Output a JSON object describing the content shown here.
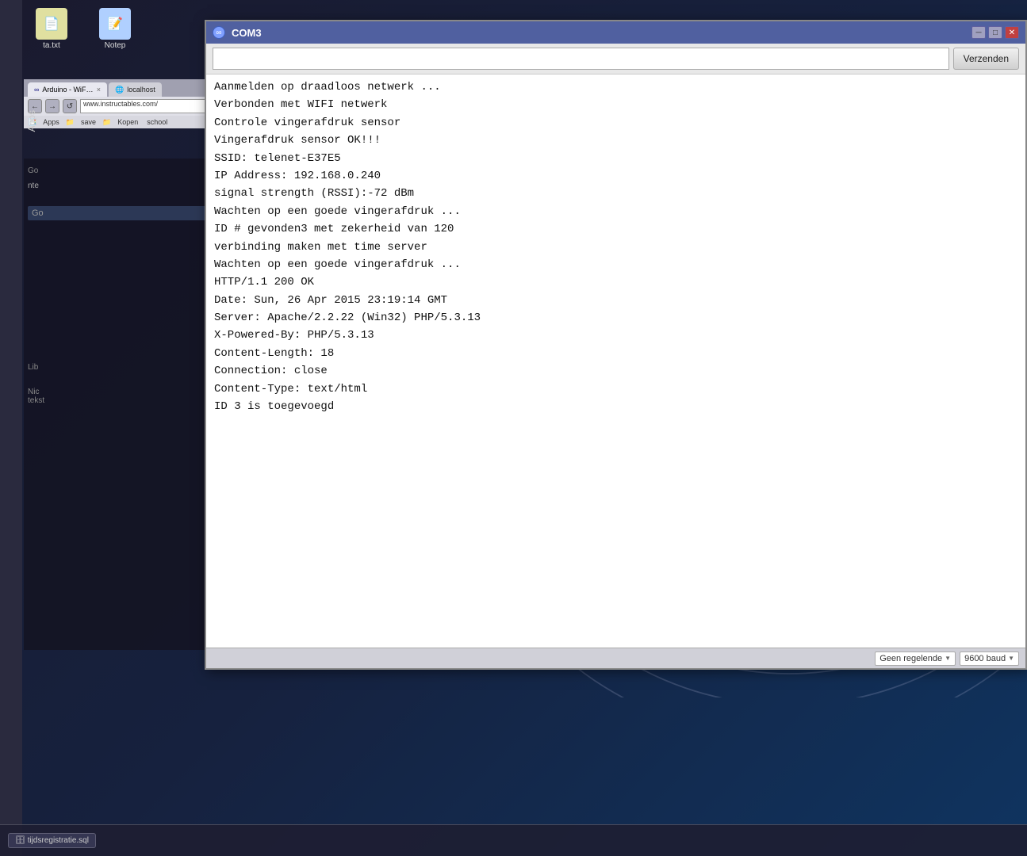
{
  "desktop": {
    "background_color": "#1a1a2e"
  },
  "taskbar": {
    "item_label": "tijdsregistratie.sql"
  },
  "apps_label": "Apps",
  "left_icons": [
    {
      "label": "ta.txt",
      "icon": "📄"
    },
    {
      "label": "Notep",
      "icon": "📝"
    }
  ],
  "browser": {
    "tabs": [
      {
        "label": "Arduino - WiFiClient",
        "active": true,
        "has_close": true
      },
      {
        "label": "localhost",
        "active": false,
        "has_close": false
      }
    ],
    "nav_buttons": [
      "←",
      "→",
      "↺"
    ],
    "address": "www.instructables.com/",
    "bookmarks": [
      {
        "label": "Apps"
      },
      {
        "label": "save"
      },
      {
        "label": "Kopen"
      },
      {
        "label": "school"
      }
    ]
  },
  "com3_window": {
    "title": "COM3",
    "icon": "∞",
    "controls": {
      "minimize": "─",
      "restore": "□",
      "close": "✕"
    },
    "input_placeholder": "",
    "send_button": "Verzenden",
    "output_lines": [
      "Aanmelden op draadloos netwerk ...",
      "Verbonden met WIFI netwerk",
      "Controle vingerafdruk sensor",
      "Vingerafdruk sensor OK!!!",
      "SSID: telenet-E37E5",
      "IP Address: 192.168.0.240",
      "signal strength (RSSI):-72 dBm",
      "Wachten op een goede vingerafdruk ...",
      "ID # gevonden3 met zekerheid van 120",
      "verbinding maken met time server",
      "Wachten op een goede vingerafdruk ...",
      "HTTP/1.1 200 OK",
      "Date: Sun, 26 Apr 2015 23:19:14 GMT",
      "Server: Apache/2.2.22 (Win32) PHP/5.3.13",
      "X-Powered-By: PHP/5.3.13",
      "Content-Length: 18",
      "Connection: close",
      "Content-Type: text/html",
      "",
      "ID 3 is toegevoegd"
    ],
    "statusbar": {
      "line_ending": "Geen regelende",
      "baud_rate": "9600 baud"
    }
  },
  "left_sidebar_labels": [
    "Go",
    "nte",
    "Go",
    "Lib",
    "Nic",
    "tekst"
  ]
}
